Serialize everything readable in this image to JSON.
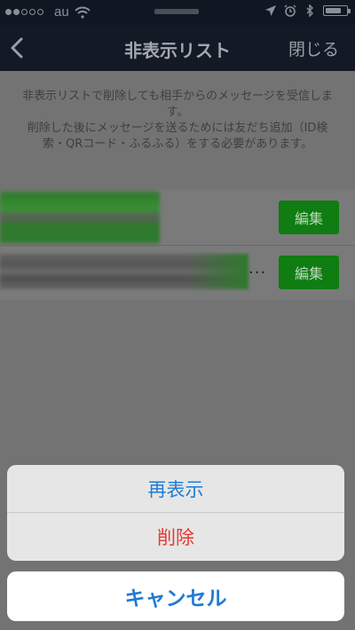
{
  "status_bar": {
    "carrier": "au",
    "signal": [
      true,
      true,
      false,
      false,
      false
    ]
  },
  "nav": {
    "title": "非表示リスト",
    "close_label": "閉じる"
  },
  "notice": {
    "line1": "非表示リストで削除しても相手からのメッセージを受信します。",
    "line2": "削除した後にメッセージを送るためには友だち追加（ID検索・QRコード・ふるふる）をする必要があります。"
  },
  "list": {
    "rows": [
      {
        "edit_label": "編集"
      },
      {
        "edit_label": "編集",
        "ellipsis": "..."
      }
    ]
  },
  "action_sheet": {
    "redisplay_label": "再表示",
    "delete_label": "削除",
    "cancel_label": "キャンセル"
  },
  "colors": {
    "accent_blue": "#1f7bd6",
    "delete_red": "#e43b2e",
    "edit_green": "#0f7d12"
  }
}
